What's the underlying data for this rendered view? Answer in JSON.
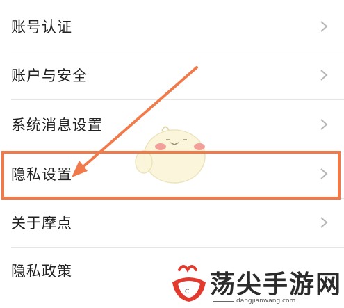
{
  "settings": {
    "items": [
      {
        "label": "账号认证"
      },
      {
        "label": "账户与安全"
      },
      {
        "label": "系统消息设置"
      },
      {
        "label": "隐私设置"
      },
      {
        "label": "关于摩点"
      },
      {
        "label": "隐私政策"
      }
    ]
  },
  "annotation": {
    "highlight_color": "#f07a4a",
    "highlighted_item": "隐私设置"
  },
  "watermark": {
    "brand": "荡尖手游网",
    "url": "dangjianwang.com"
  },
  "colors": {
    "text": "#222222",
    "chevron": "#b5b5b5",
    "divider": "#e6e6e6",
    "mascot_blush": "#f08a8a"
  }
}
